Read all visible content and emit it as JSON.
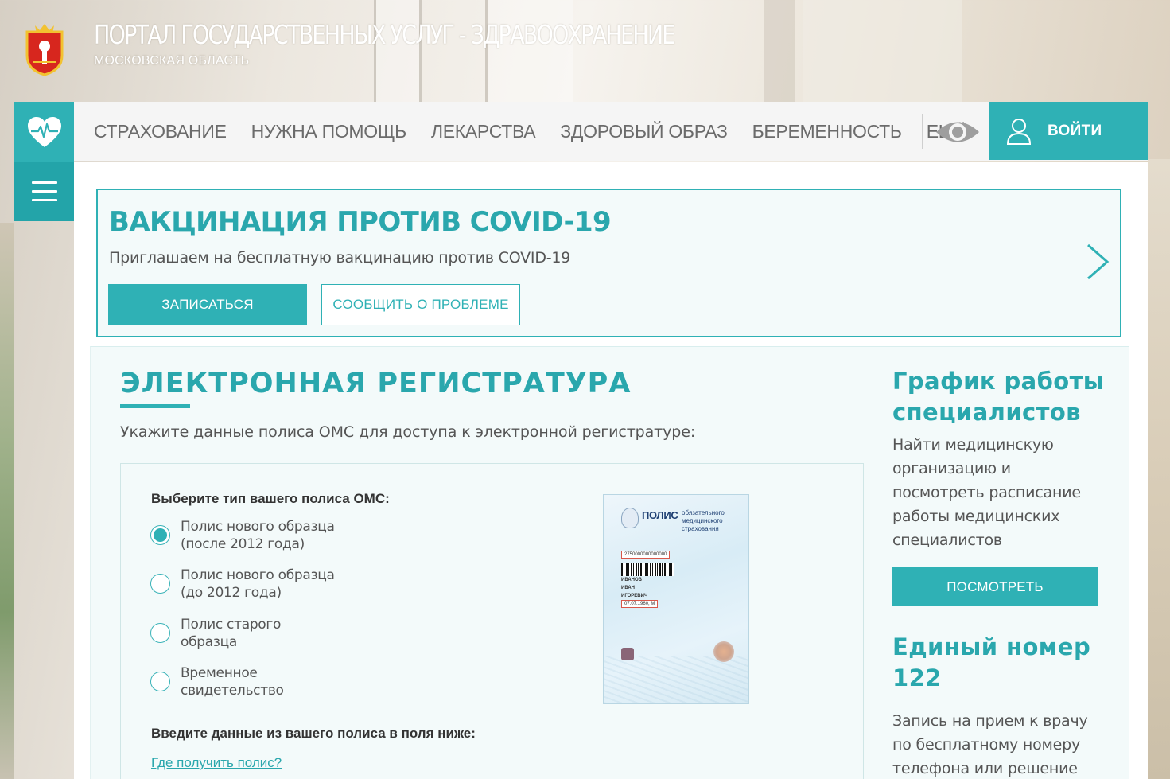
{
  "header": {
    "title": "ПОРТАЛ ГОСУДАРСТВЕННЫХ УСЛУГ - ЗДРАВООХРАНЕНИЕ",
    "subtitle": "МОСКОВСКАЯ ОБЛАСТЬ",
    "logo_icon": "coat-of-arms-icon"
  },
  "nav": {
    "items": [
      {
        "label": "СТРАХОВАНИЕ"
      },
      {
        "label": "НУЖНА ПОМОЩЬ"
      },
      {
        "label": "ЛЕКАРСТВА"
      },
      {
        "label": "ЗДОРОВЫЙ ОБРАЗ"
      },
      {
        "label": "БЕРЕМЕННОСТЬ"
      },
      {
        "label": "ЕЩЁ"
      }
    ],
    "login_label": "ВОЙТИ",
    "accessibility_icon": "eye-icon",
    "home_icon": "heart-pulse-icon",
    "menu_icon": "hamburger-menu-icon"
  },
  "banner": {
    "title": "ВАКЦИНАЦИЯ ПРОТИВ COVID-19",
    "text": "Приглашаем на бесплатную вакцинацию против COVID-19",
    "primary_button": "ЗАПИСАТЬСЯ",
    "secondary_button": "СООБЩИТЬ О ПРОБЛЕМЕ",
    "next_icon": "chevron-right-icon"
  },
  "registry": {
    "title": "ЭЛЕКТРОННАЯ РЕГИСТРАТУРА",
    "instruction": "Укажите данные полиса ОМС для доступа к электронной регистратуре:",
    "policy_type_label": "Выберите тип вашего полиса ОМС:",
    "options": [
      {
        "line1": "Полис нового образца",
        "line2": "(после 2012 года)",
        "checked": true
      },
      {
        "line1": "Полис нового образца",
        "line2": "(до 2012 года)",
        "checked": false
      },
      {
        "line1": "Полис старого",
        "line2": "образца",
        "checked": false
      },
      {
        "line1": "Временное",
        "line2": "свидетельство",
        "checked": false
      }
    ],
    "data_label": "Введите данные из вашего полиса в поля ниже:",
    "help_link": "Где получить полис?",
    "policy_image": {
      "heading": "ПОЛИС",
      "subheading_1": "обязательного",
      "subheading_2": "медицинского страхования",
      "number": "2750000000000000",
      "surname": "ИВАНОВ",
      "name": "ИВАН",
      "patronymic": "ИГОРЕВИЧ",
      "birth": "07.07.1960, М"
    }
  },
  "schedule": {
    "title_line1": "График работы",
    "title_line2": "специалистов",
    "text": [
      "Найти медицинскую",
      "организацию и",
      "посмотреть расписание",
      "работы медицинских",
      "специалистов"
    ],
    "button": "ПОСМОТРЕТЬ"
  },
  "hotline": {
    "title_line1": "Единый номер",
    "title_line2": "122",
    "text": [
      "Запись на прием к врачу",
      "по бесплатному номеру",
      "телефона или решение"
    ]
  },
  "colors": {
    "accent": "#2fb1b5",
    "accent_dark": "#23a4a9",
    "heading": "#2aa7ad",
    "nav_bg": "#f5f5f5",
    "panel_bg": "#f3fafa"
  }
}
